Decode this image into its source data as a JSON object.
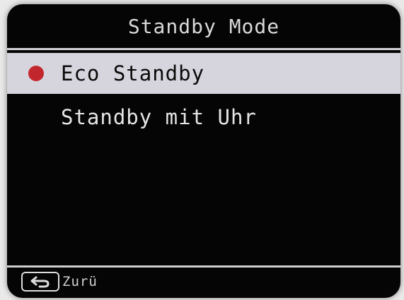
{
  "screen": {
    "title": "Standby Mode"
  },
  "menu": {
    "items": [
      {
        "label": "Eco Standby",
        "selected": true
      },
      {
        "label": "Standby mit Uhr",
        "selected": false
      }
    ]
  },
  "footer": {
    "back_icon": "return-arrow-icon",
    "back_label": "Zurü"
  },
  "colors": {
    "background": "#050505",
    "selection_bar": "#d6d4dc",
    "radio_selected": "#c2272d",
    "text_light": "#e6e6e6",
    "text_dark": "#0a0a0a"
  }
}
